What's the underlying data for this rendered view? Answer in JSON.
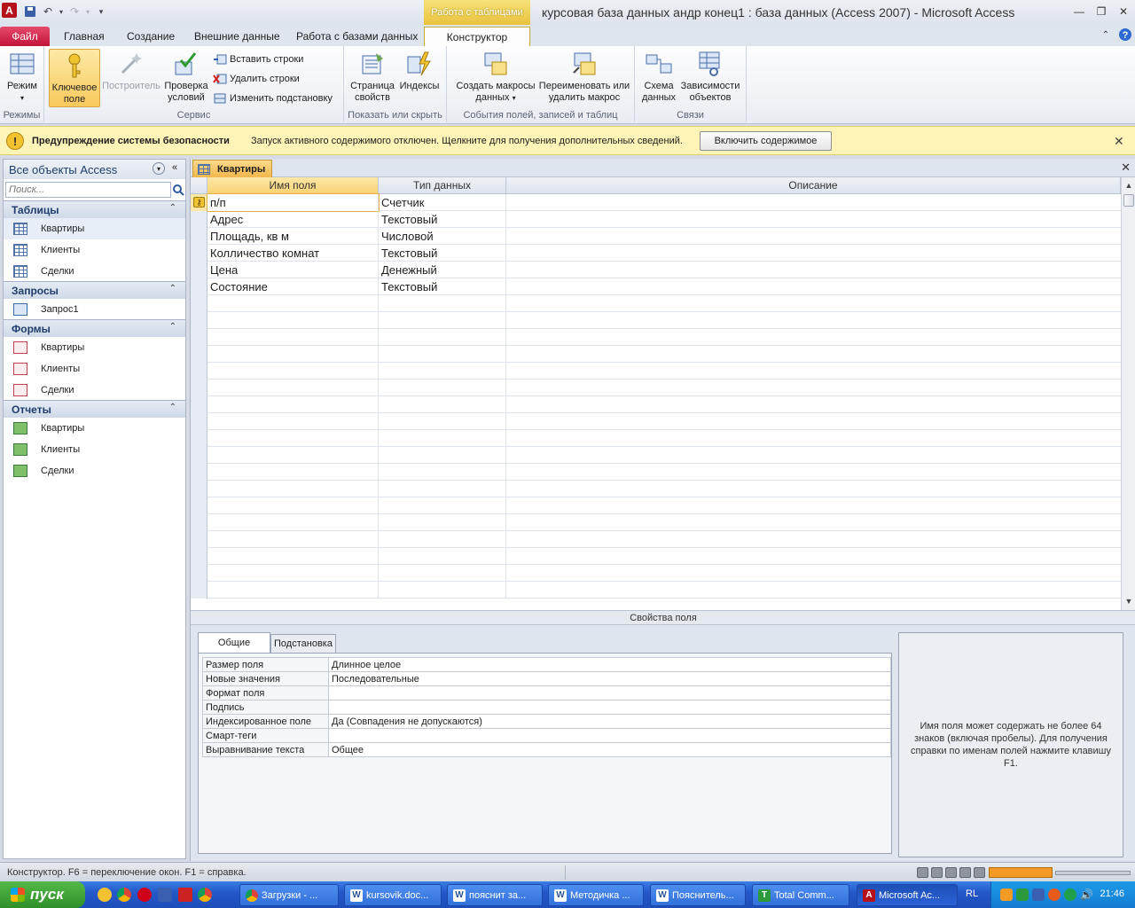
{
  "window": {
    "title": "курсовая база данных андр конец1 : база данных (Access 2007)  -  Microsoft Access",
    "context_tab_group": "Работа с таблицами",
    "app_icon_letter": "A"
  },
  "ribbon_tabs": {
    "file": "Файл",
    "home": "Главная",
    "create": "Создание",
    "external": "Внешние данные",
    "database_tools": "Работа с базами данных",
    "design": "Конструктор"
  },
  "ribbon": {
    "groups": {
      "views": "Режимы",
      "tools": "Сервис",
      "show_hide": "Показать или скрыть",
      "events": "События полей, записей и таблиц",
      "relationships": "Связи"
    },
    "buttons": {
      "view_line1": "Режим",
      "primary_key_line1": "Ключевое",
      "primary_key_line2": "поле",
      "builder": "Построитель",
      "test_rules_line1": "Проверка",
      "test_rules_line2": "условий",
      "insert_rows": "Вставить строки",
      "delete_rows": "Удалить строки",
      "modify_lookups": "Изменить подстановку",
      "property_sheet_line1": "Страница",
      "property_sheet_line2": "свойств",
      "indexes": "Индексы",
      "create_macros_line1": "Создать макросы",
      "create_macros_line2": "данных",
      "rename_macro_line1": "Переименовать или",
      "rename_macro_line2": "удалить макрос",
      "relationships_line1": "Схема",
      "relationships_line2": "данных",
      "dependencies_line1": "Зависимости",
      "dependencies_line2": "объектов"
    }
  },
  "security_bar": {
    "title": "Предупреждение системы безопасности",
    "message": "Запуск активного содержимого отключен. Щелкните для получения дополнительных сведений.",
    "button": "Включить содержимое"
  },
  "nav_pane": {
    "title": "Все объекты Access",
    "search_placeholder": "Поиск...",
    "sections": [
      {
        "label": "Таблицы",
        "items": [
          "Квартиры",
          "Клиенты",
          "Сделки"
        ]
      },
      {
        "label": "Запросы",
        "items": [
          "Запрос1"
        ]
      },
      {
        "label": "Формы",
        "items": [
          "Квартиры",
          "Клиенты",
          "Сделки"
        ]
      },
      {
        "label": "Отчеты",
        "items": [
          "Квартиры",
          "Клиенты",
          "Сделки"
        ]
      }
    ]
  },
  "document": {
    "tab_label": "Квартиры",
    "columns": [
      "Имя поля",
      "Тип данных",
      "Описание"
    ],
    "rows": [
      {
        "name": "п/п",
        "type": "Счетчик",
        "desc": ""
      },
      {
        "name": "Адрес",
        "type": "Текстовый",
        "desc": ""
      },
      {
        "name": "Площадь, кв м",
        "type": "Числовой",
        "desc": ""
      },
      {
        "name": "Колличество комнат",
        "type": "Текстовый",
        "desc": ""
      },
      {
        "name": "Цена",
        "type": "Денежный",
        "desc": ""
      },
      {
        "name": "Состояние",
        "type": "Текстовый",
        "desc": ""
      }
    ],
    "field_properties_title": "Свойства поля",
    "prop_tabs": [
      "Общие",
      "Подстановка"
    ],
    "properties": [
      {
        "name": "Размер поля",
        "value": "Длинное целое"
      },
      {
        "name": "Новые значения",
        "value": "Последовательные"
      },
      {
        "name": "Формат поля",
        "value": ""
      },
      {
        "name": "Подпись",
        "value": ""
      },
      {
        "name": "Индексированное поле",
        "value": "Да (Совпадения не допускаются)"
      },
      {
        "name": "Смарт-теги",
        "value": ""
      },
      {
        "name": "Выравнивание текста",
        "value": "Общее"
      }
    ],
    "help_text": "Имя поля может содержать не более 64 знаков (включая пробелы). Для получения справки по именам полей нажмите клавишу F1."
  },
  "status_bar": {
    "text": "Конструктор.  F6 = переключение окон.  F1 = справка."
  },
  "taskbar": {
    "start": "пуск",
    "tasks": [
      {
        "label": "Загрузки - ...",
        "icon": "chrome-icon"
      },
      {
        "label": "kursovik.doc...",
        "icon": "word-icon"
      },
      {
        "label": "пояснит за...",
        "icon": "word-icon"
      },
      {
        "label": "Методичка ...",
        "icon": "word-icon"
      },
      {
        "label": "Пояснитель...",
        "icon": "word-icon"
      },
      {
        "label": "Total Comm...",
        "icon": "total-commander-icon"
      },
      {
        "label": "Microsoft Ac...",
        "icon": "access-icon"
      }
    ],
    "lang": "RL",
    "clock": "21:46"
  },
  "colors": {
    "file_tab": "#c3133a",
    "context_tab": "#e9c23c",
    "security_bar": "#fff4b8",
    "taskbar": "#2458c9"
  }
}
